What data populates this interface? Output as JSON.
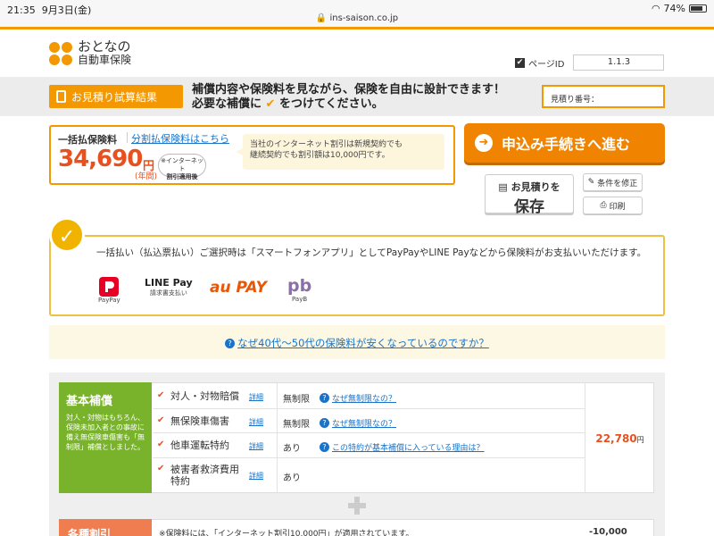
{
  "status_bar": {
    "time": "21:35",
    "date": "9月3日(金)",
    "url": "ins-saison.co.jp",
    "battery": "74%"
  },
  "header": {
    "logo_line1": "おとなの",
    "logo_line2": "自動車保険",
    "page_id_label": "ページID",
    "page_id_value": "1.1.3"
  },
  "estimate_bar": {
    "tag_label": "お見積り試算結果",
    "message_line1": "補償内容や保険料を見ながら、保険を自由に設計できます！",
    "message_line2_pre": "必要な補償に",
    "message_line2_check": "✔",
    "message_line2_post": "をつけてください。",
    "estimate_no_label": "見積り番号："
  },
  "price": {
    "label": "一括払保険料",
    "installment_link": "分割払保険料はこちら",
    "amount": "34,690",
    "yen": "円",
    "period": "(年間)",
    "badge_line1": "※インターネット",
    "badge_line2": "割引適用後",
    "note_line1": "当社のインターネット割引は新規契約でも",
    "note_line2": "継続契約でも割引額は10,000円です。"
  },
  "actions": {
    "apply": "申込み手続きへ進む",
    "save_line1": "お見積りを",
    "save_line2": "保存",
    "modify": "条件を修正",
    "print": "印刷"
  },
  "payment": {
    "text": "一括払い（払込票払い）ご選択時は「スマートフォンアプリ」としてPayPayやLINE Payなどから保険料がお支払いいただけます。",
    "logos": [
      {
        "name": "PayPay",
        "sub": "PayPay"
      },
      {
        "name": "LINE Pay",
        "sub": "請求書支払い"
      },
      {
        "name": "au PAY",
        "sub": ""
      },
      {
        "name": "pb",
        "sub": "PayB"
      }
    ]
  },
  "faq": {
    "link": "なぜ40代～50代の保険料が安くなっているのですか？"
  },
  "coverage": {
    "title": "基本補償",
    "description": "対人・対物はもちろん、保険未加入者との事故に備え無保険車傷害も「無制限」補償としました。",
    "detail_label": "詳細",
    "rows": [
      {
        "name": "対人・対物賠償",
        "value": "無制限",
        "question": "なぜ無制限なの？"
      },
      {
        "name": "無保険車傷害",
        "value": "無制限",
        "question": "なぜ無制限なの？"
      },
      {
        "name": "他車運転特約",
        "value": "あり",
        "question": "この特約が基本補償に入っている理由は？"
      },
      {
        "name": "被害者救済費用特約",
        "value": "あり",
        "question": ""
      }
    ],
    "price": "22,780",
    "price_unit": "円"
  },
  "discount": {
    "title": "各種割引",
    "text": "※保険料には、「インターネット割引10,000円」が適用されています。",
    "price": "-10,000"
  },
  "colors": {
    "accent": "#f39800",
    "price": "#e8501f",
    "link": "#1a73c8",
    "coverage": "#79b32b"
  }
}
